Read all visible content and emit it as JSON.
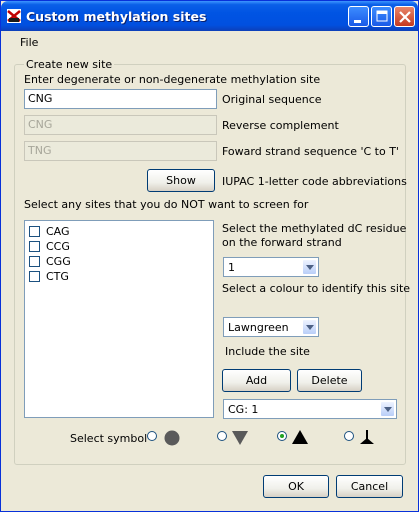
{
  "window": {
    "title": "Custom methylation sites"
  },
  "menu": {
    "file": "File"
  },
  "group": {
    "legend": "Create new site",
    "instruction": "Enter degenerate or non-degenerate methylation site"
  },
  "fields": {
    "original": {
      "value": "CNG",
      "label": "Original sequence"
    },
    "reverse": {
      "value": "CNG",
      "label": "Reverse complement"
    },
    "forward": {
      "value": "TNG",
      "label": "Foward strand sequence 'C to T'"
    }
  },
  "show_button": "Show",
  "iupac_label": "IUPAC 1-letter code abbreviations",
  "screen_label": "Select any sites that you do NOT want to screen for",
  "sites": [
    "CAG",
    "CCG",
    "CGG",
    "CTG"
  ],
  "residue": {
    "label_line1": "Select the methylated dC residue",
    "label_line2": "on the forward strand",
    "selected": "1"
  },
  "colour": {
    "label": "Select a colour to identify this site",
    "selected": "Lawngreen"
  },
  "include_label": "Include the site",
  "add_button": "Add",
  "delete_button": "Delete",
  "site_combo": {
    "selected": "CG: 1"
  },
  "symbol_label": "Select symbol",
  "symbols": [
    {
      "icon": "circle-symbol-icon",
      "selected": false
    },
    {
      "icon": "down-triangle-symbol-icon",
      "selected": false
    },
    {
      "icon": "up-triangle-symbol-icon",
      "selected": true
    },
    {
      "icon": "pin-symbol-icon",
      "selected": false
    }
  ],
  "ok_button": "OK",
  "cancel_button": "Cancel",
  "colors": {
    "titlebar": "#0054e3",
    "face": "#ece9d8",
    "radio_dot": "#21a121"
  }
}
